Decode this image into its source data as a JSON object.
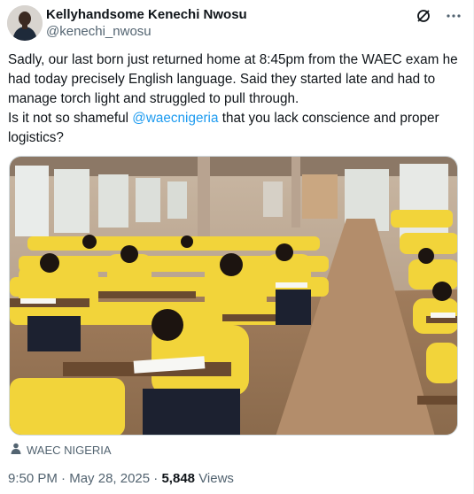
{
  "author": {
    "display_name": "Kellyhandsome Kenechi Nwosu",
    "handle": "@kenechi_nwosu"
  },
  "header_icons": [
    "grok-icon",
    "more-icon"
  ],
  "tweet": {
    "line1": "Sadly, our last born just returned home at 8:45pm from the WAEC exam he had today precisely English language. Said they started late and had to manage torch light and struggled to pull through.",
    "line2_prefix": "Is it not so shameful ",
    "mention": "@waecnigeria",
    "line2_suffix": " that you lack conscience and proper logistics?"
  },
  "media": {
    "source_label": "WAEC NIGERIA"
  },
  "meta": {
    "time": "9:50 PM",
    "separator": "·",
    "date": "May 28, 2025",
    "views_count": "5,848",
    "views_label": "Views"
  },
  "colors": {
    "link": "#1d9bf0",
    "secondary_text": "#536471",
    "primary_text": "#0f1419",
    "uniform_yellow": "#f2d43a"
  }
}
